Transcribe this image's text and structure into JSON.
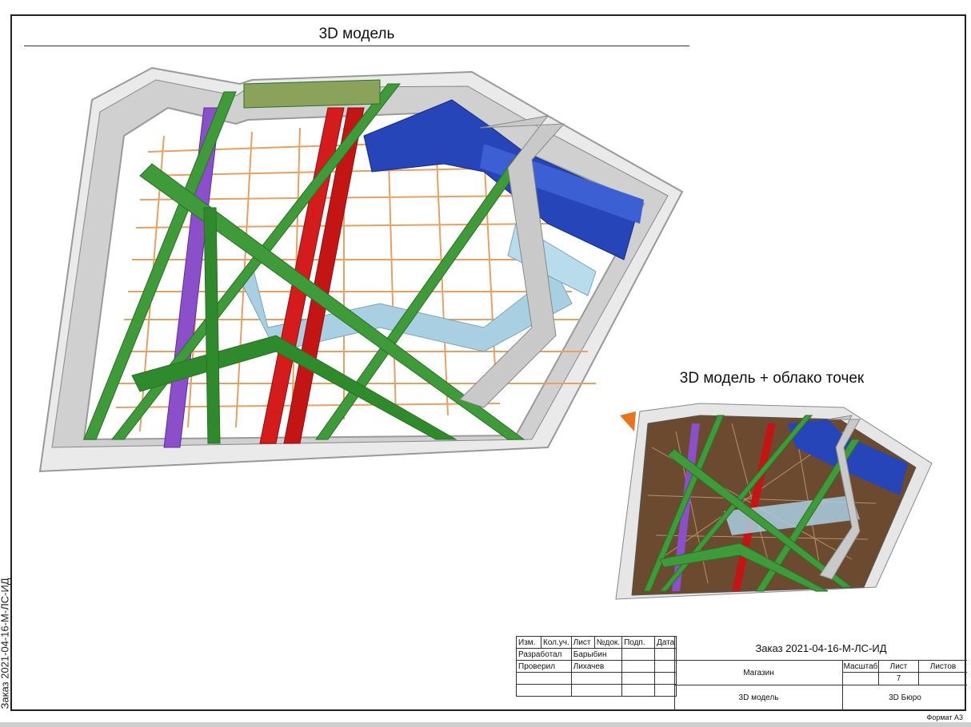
{
  "sheet": {
    "title_main": "3D модель",
    "title_sub": "3D модель + облако точек",
    "side_stamp": "Заказ 2021-04-16-М-ЛС-ИД",
    "format": "Формат А3"
  },
  "title_block": {
    "headers": [
      "Изм.",
      "Кол.уч.",
      "Лист",
      "№док.",
      "Подп.",
      "Дата"
    ],
    "developed_label": "Разработал",
    "developed_name": "Барыбин",
    "checked_label": "Проверил",
    "checked_name": "Лихачев",
    "order": "Заказ 2021-04-16-М-ЛС-ИД",
    "object": "Магазин",
    "scale_label": "Масштаб",
    "sheet_label": "Лист",
    "sheets_label": "Листов",
    "sheet_number": "7",
    "drawing_name": "3D модель",
    "company": "3D Бюро"
  },
  "colors": {
    "wall": "#c9c9c9",
    "wall_top": "#e6e6e6",
    "beam_green": "#3f9a3a",
    "beam_olive": "#8aa25a",
    "duct_red": "#d51c1c",
    "duct_purple": "#8a4fc9",
    "duct_blue": "#2545b8",
    "duct_lightblue": "#a9cfe2",
    "grid_orange": "#e7a060"
  }
}
